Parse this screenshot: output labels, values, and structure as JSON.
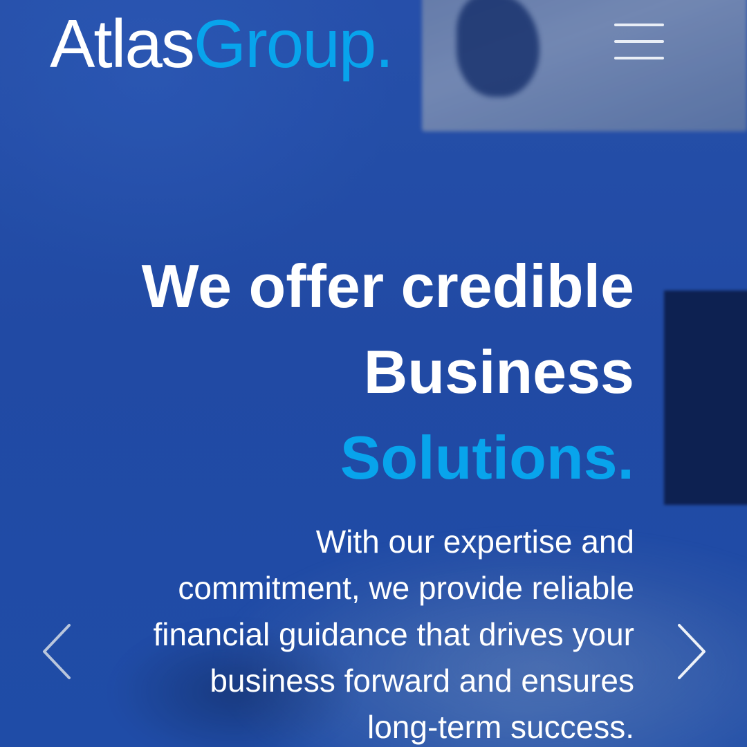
{
  "brand": {
    "name_part1": "Atlas",
    "name_part2": "Group",
    "dot": "."
  },
  "header": {
    "menu_icon": "hamburger-menu-icon"
  },
  "hero": {
    "headline_line1": "We offer credible",
    "headline_line2": "Business",
    "headline_line3": "Solutions.",
    "body_lines": [
      "With our expertise and",
      "commitment, we provide reliable",
      "financial guidance that drives your",
      "business forward and ensures",
      "long-term success."
    ]
  },
  "carousel": {
    "prev_icon": "chevron-left-icon",
    "next_icon": "chevron-right-icon"
  },
  "colors": {
    "accent": "#08a4ec",
    "background": "#234a9c",
    "text": "#ffffff"
  }
}
